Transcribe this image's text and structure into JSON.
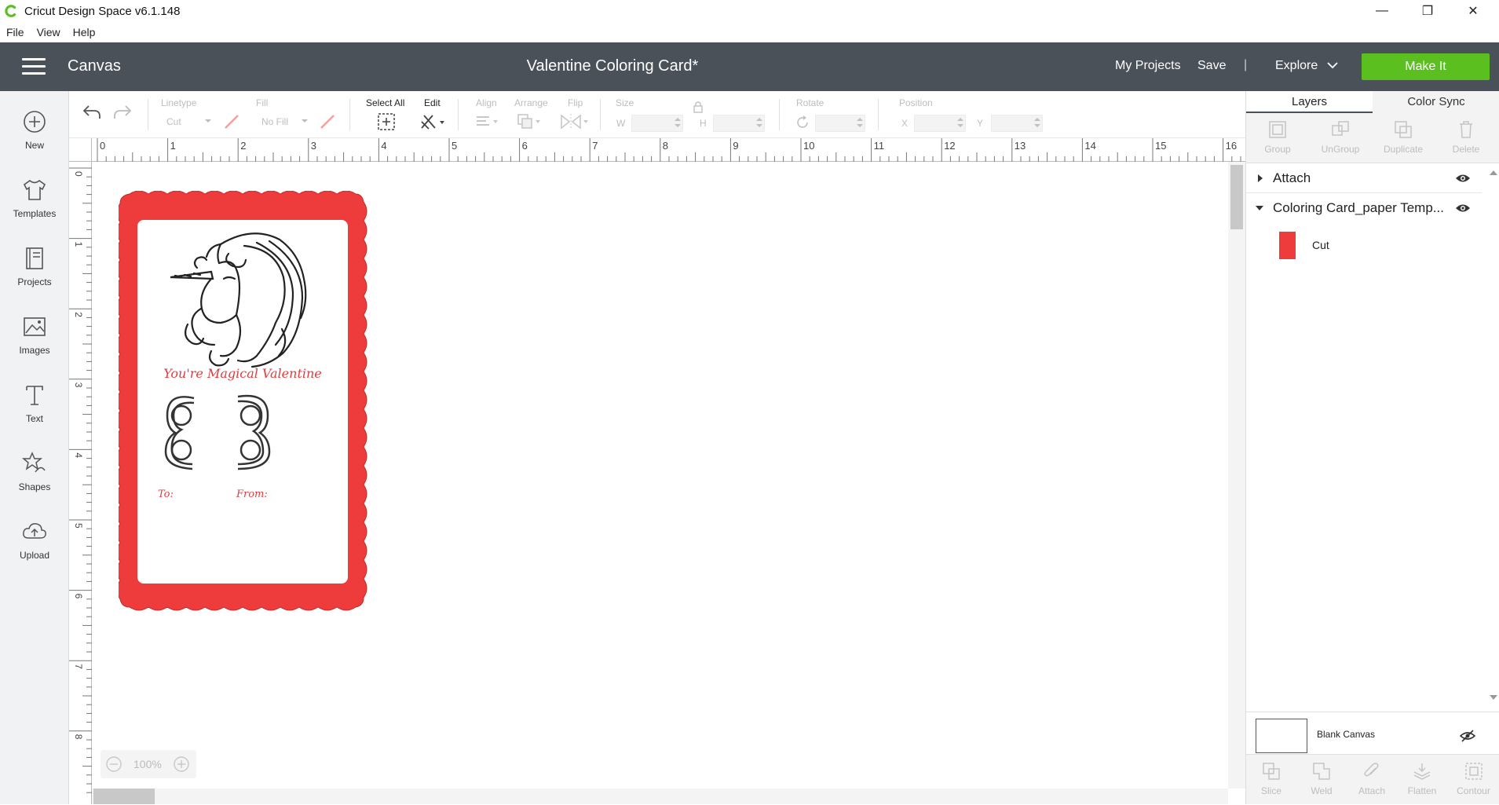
{
  "window": {
    "app_title": "Cricut Design Space  v6.1.148",
    "minimize": "—",
    "restore": "❐",
    "close": "✕"
  },
  "menu": {
    "items": [
      "File",
      "View",
      "Help"
    ]
  },
  "header": {
    "section_title": "Canvas",
    "document_title": "Valentine Coloring Card*",
    "my_projects": "My Projects",
    "save": "Save",
    "separator": "|",
    "explore": "Explore",
    "make_it": "Make It"
  },
  "sidebar": {
    "items": [
      {
        "label": "New",
        "icon": "plus-circle-icon"
      },
      {
        "label": "Templates",
        "icon": "tshirt-icon"
      },
      {
        "label": "Projects",
        "icon": "projects-icon"
      },
      {
        "label": "Images",
        "icon": "image-icon"
      },
      {
        "label": "Text",
        "icon": "text-icon"
      },
      {
        "label": "Shapes",
        "icon": "shapes-icon"
      },
      {
        "label": "Upload",
        "icon": "upload-icon"
      }
    ]
  },
  "toolbar": {
    "linetype_label": "Linetype",
    "linetype_value": "Cut",
    "fill_label": "Fill",
    "fill_value": "No Fill",
    "select_all_label": "Select All",
    "edit_label": "Edit",
    "align_label": "Align",
    "arrange_label": "Arrange",
    "flip_label": "Flip",
    "size_label": "Size",
    "size_w": "W",
    "size_h": "H",
    "rotate_label": "Rotate",
    "position_label": "Position",
    "position_x": "X",
    "position_y": "Y"
  },
  "ruler": {
    "horizontal": [
      "0",
      "1",
      "2",
      "3",
      "4",
      "5",
      "6",
      "7",
      "8",
      "9",
      "10",
      "11",
      "12",
      "13",
      "14",
      "15",
      "16"
    ],
    "vertical": [
      "0",
      "1",
      "2",
      "3",
      "4",
      "5",
      "6",
      "7",
      "8"
    ]
  },
  "card": {
    "greeting": "You're Magical Valentine",
    "to_label": "To:",
    "from_label": "From:",
    "frame_color": "#ee3b3b",
    "text_color": "#e23c3c"
  },
  "zoom": {
    "minus": "−",
    "value": "100%",
    "plus": "+"
  },
  "panel": {
    "tabs": [
      "Layers",
      "Color Sync"
    ],
    "top_tools": [
      "Group",
      "UnGroup",
      "Duplicate",
      "Delete"
    ],
    "layers": [
      {
        "name": "Attach",
        "expanded": false
      },
      {
        "name": "Coloring Card_paper Temp...",
        "expanded": true
      }
    ],
    "sublayer": {
      "name": "Cut",
      "color": "#ee3b3b"
    },
    "blank_canvas": "Blank Canvas",
    "bottom_tools": [
      "Slice",
      "Weld",
      "Attach",
      "Flatten",
      "Contour"
    ]
  },
  "colors": {
    "header_bg": "#4a5159",
    "make_it_green": "#5bbf1f",
    "accent_red": "#ee3b3b"
  }
}
